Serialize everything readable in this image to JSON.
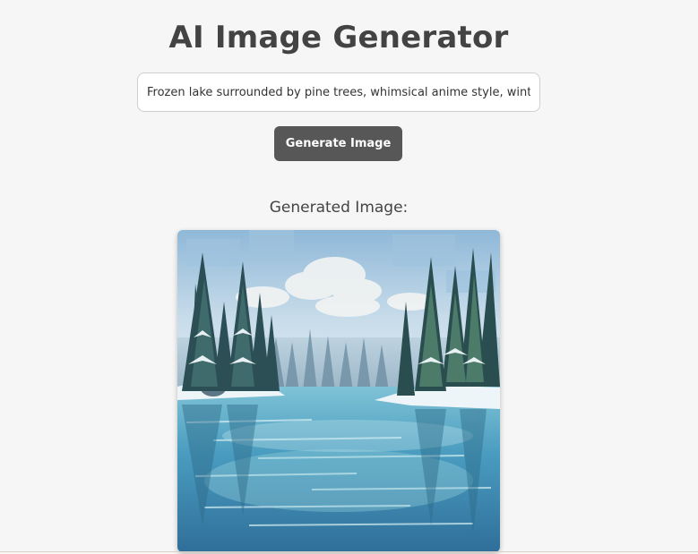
{
  "app": {
    "title": "AI Image Generator"
  },
  "prompt": {
    "value": "Frozen lake surrounded by pine trees, whimsical anime style, winter"
  },
  "generate_button": {
    "label": "Generate Image"
  },
  "result": {
    "heading": "Generated Image:"
  }
}
